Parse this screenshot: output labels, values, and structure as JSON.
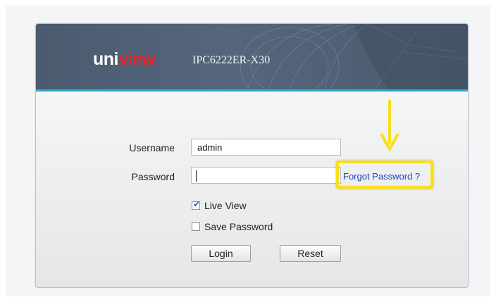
{
  "header": {
    "logo_main": "uni",
    "logo_accent": "view",
    "model": "IPC6222ER-X30"
  },
  "form": {
    "username_label": "Username",
    "username_value": "admin",
    "password_label": "Password",
    "password_value": "",
    "forgot_link": "Forgot Password ?",
    "live_view_label": "Live View",
    "live_view_checked": true,
    "save_password_label": "Save Password",
    "save_password_checked": false,
    "login_button": "Login",
    "reset_button": "Reset"
  },
  "annotation": {
    "arrow_icon": "down-arrow-icon",
    "highlight_color": "#f8df1c"
  },
  "colors": {
    "header_bg": "#4f5f74",
    "accent_line": "#32a9cf",
    "logo_red": "#e2262a",
    "link": "#1c44b8"
  }
}
